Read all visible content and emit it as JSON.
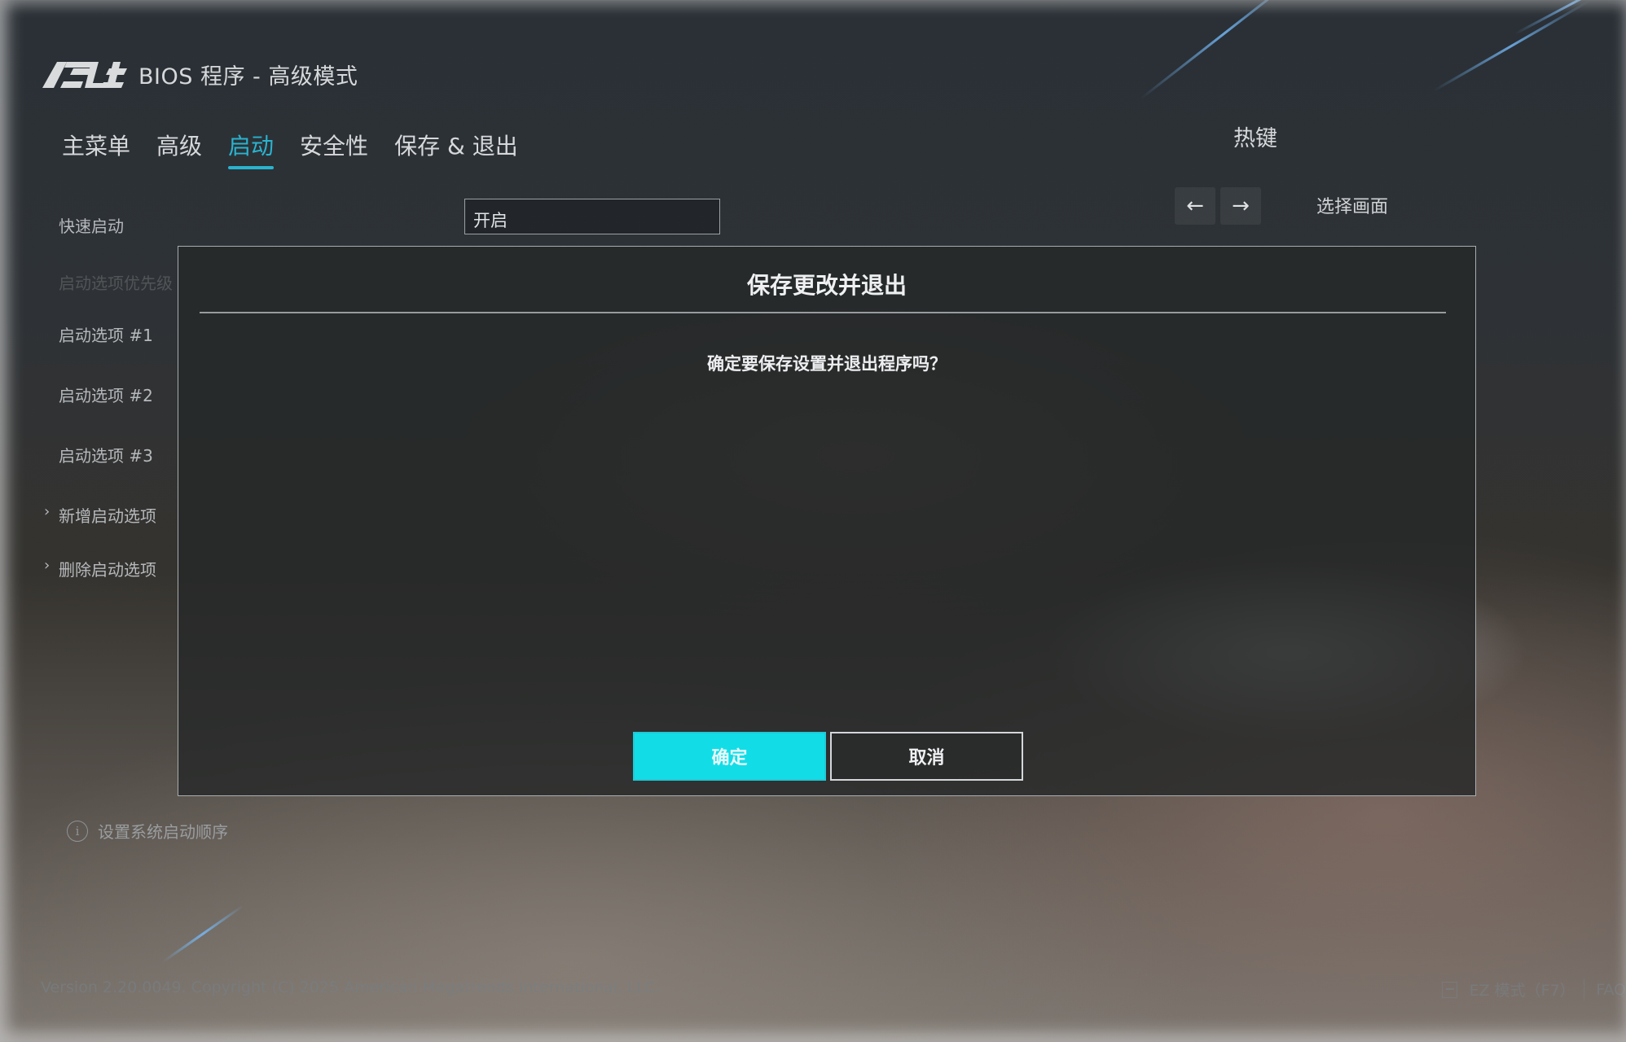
{
  "header": {
    "logo_text": "ASUS",
    "app_title": "BIOS 程序 - 高级模式"
  },
  "tabs": [
    {
      "label": "主菜单",
      "active": false
    },
    {
      "label": "高级",
      "active": false
    },
    {
      "label": "启动",
      "active": true
    },
    {
      "label": "安全性",
      "active": false
    },
    {
      "label": "保存 & 退出",
      "active": false
    }
  ],
  "hotkeys": {
    "title": "热键",
    "left_arrow": "←",
    "right_arrow": "→",
    "select_screen": "选择画面"
  },
  "boot_menu": {
    "fast_boot_label": "快速启动",
    "fast_boot_value": "开启",
    "priority_label": "启动选项优先级",
    "option1": "启动选项 #1",
    "option2": "启动选项 #2",
    "option3": "启动选项 #3",
    "add_option": "新增启动选项",
    "delete_option": "删除启动选项",
    "chevron": "›"
  },
  "dialog": {
    "title": "保存更改并退出",
    "message": "确定要保存设置并退出程序吗？",
    "ok_label": "确定",
    "cancel_label": "取消"
  },
  "help": {
    "icon": "i",
    "text": "设置系统启动顺序"
  },
  "footer": {
    "version": "Version 2.20.0049. Copyright (C) 2025 American Megatrends International, LLC.",
    "ez_mode": "EZ 模式（F7）",
    "faq": "FAQ"
  },
  "colors": {
    "accent": "#29b3cf",
    "ok_button": "#12dde6"
  },
  "icons": [
    "asus-logo",
    "left-arrow-icon",
    "right-arrow-icon",
    "info-icon",
    "ez-mode-icon",
    "chevron-right-icon"
  ]
}
